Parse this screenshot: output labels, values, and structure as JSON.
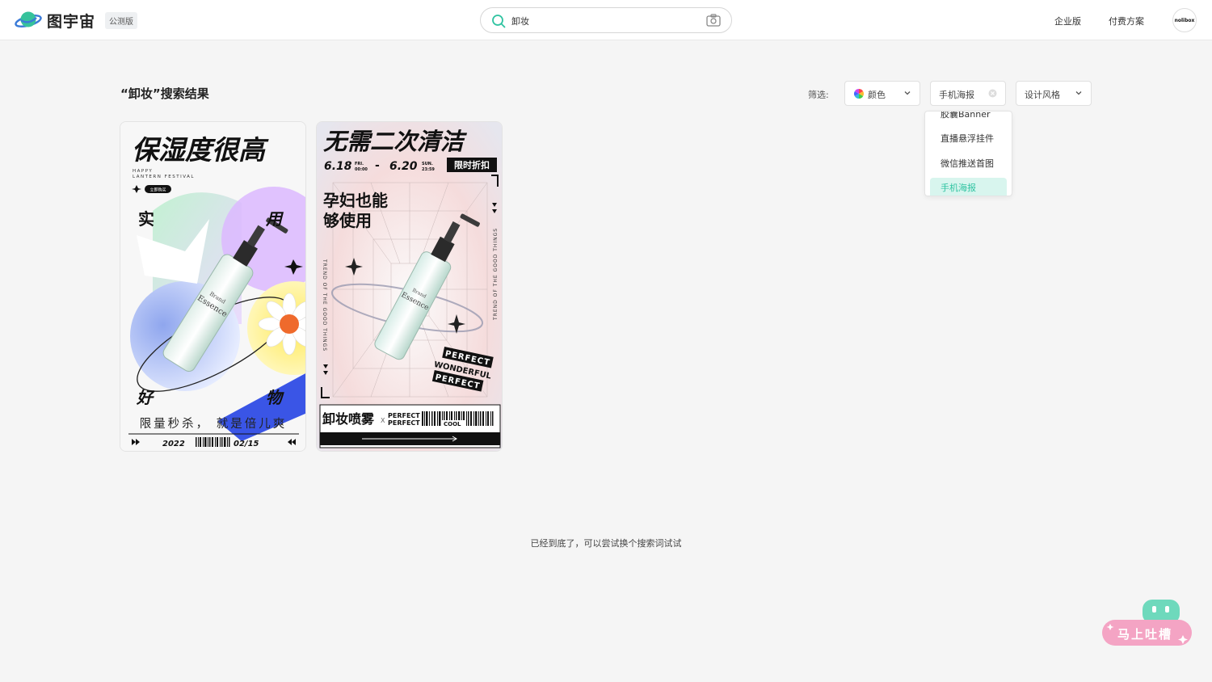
{
  "header": {
    "logo_text": "图宇宙",
    "beta_badge": "公测版",
    "search": {
      "value": "卸妆"
    },
    "nav": [
      "企业版",
      "付费方案"
    ],
    "avatar_text": "nolibox"
  },
  "results": {
    "title": "“卸妆”搜索结果"
  },
  "filters": {
    "label": "筛选:",
    "color": "颜色",
    "type": "手机海报",
    "style": "设计风格"
  },
  "dropdown": {
    "items": [
      "胶囊Banner",
      "直播悬浮挂件",
      "微信推送首图",
      "手机海报"
    ],
    "selected": "手机海报"
  },
  "cards": [
    {
      "headline": "保湿度很高",
      "sub1": "HAPPY",
      "sub2": "LANTERN FESTIVAL",
      "pill": "立即购买",
      "w1": "实",
      "w2": "用",
      "w3": "好",
      "w4": "物",
      "brand": "Brand",
      "product": "Essence",
      "slogan": "限量秒杀， 就是倍儿爽",
      "year": "2022",
      "date": "02/15"
    },
    {
      "headline": "无需二次清洁",
      "d1": "6.18",
      "d1a": "FRI.",
      "d1b": "00:00",
      "dash": "-",
      "d2": "6.20",
      "d2a": "SUN.",
      "d2b": "23:59",
      "tag": "限时折扣",
      "tag2a": "孕妇也能",
      "tag2b": "够使用",
      "side": "TREND OF THE GOOD THINGS",
      "brand": "Brand",
      "product": "Essence",
      "sticker1": "PERFECT",
      "sticker2": "WONDERFUL",
      "sticker3": "PERFECT",
      "bottom_title": "卸妆喷雾",
      "x": "X",
      "p1": "PERFECT",
      "p2": "PERFECT",
      "cool": "COOL"
    }
  ],
  "footer_text": "已经到底了，可以尝试换个搜索词试试",
  "feedback_label": "马上吐槽",
  "colors": {
    "accent": "#2fc3a1",
    "feedback": "#f48fb1"
  }
}
